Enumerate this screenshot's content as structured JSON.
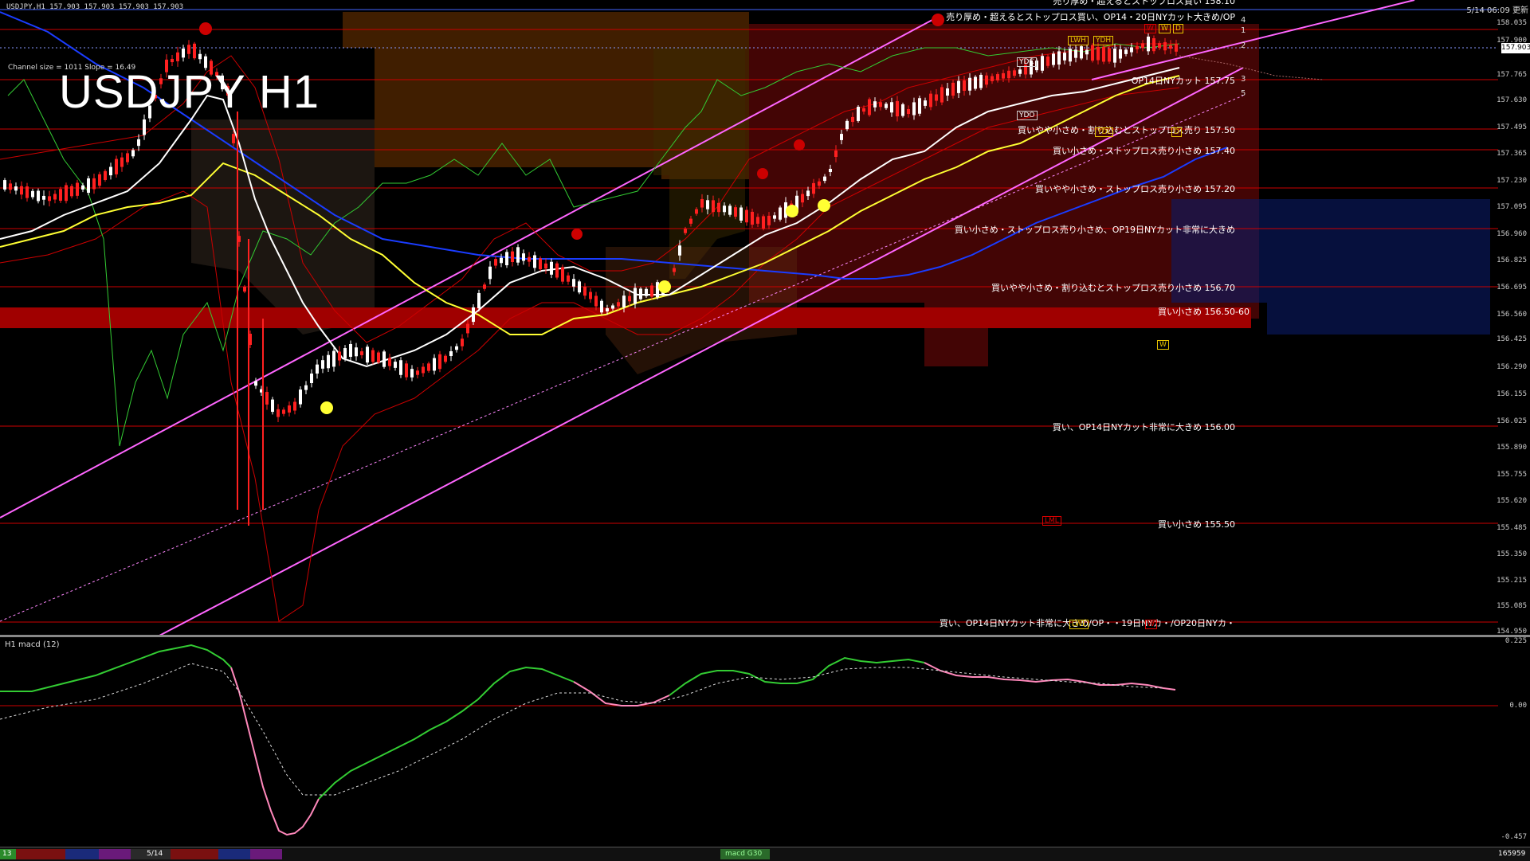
{
  "header": {
    "symbol_info": "USDJPY,H1  157.903 157.903 157.903 157.903",
    "big_title": "USDJPY H1",
    "channel_info": "Channel size = 1011 Slope = 16.49",
    "clock": "5/14 06:09 更新",
    "current_price": "157.903"
  },
  "price_axis": [
    "158.035",
    "157.900",
    "157.765",
    "157.630",
    "157.495",
    "157.365",
    "157.230",
    "157.095",
    "156.960",
    "156.825",
    "156.695",
    "156.560",
    "156.425",
    "156.290",
    "156.155",
    "156.025",
    "155.890",
    "155.755",
    "155.620",
    "155.485",
    "155.350",
    "155.215",
    "155.085",
    "154.950"
  ],
  "notes": [
    {
      "text": "売り厚め・超えるとストップロス買い 158.10"
    },
    {
      "text": "売り厚め・超えるとストップロス買い、OP14・20日NYカット大きめ/OP"
    },
    {
      "text": "OP14日NYカット 157.75"
    },
    {
      "text": "買いやや小さめ・割り込むとストップロス売り 157.50"
    },
    {
      "text": "買い小さめ・ストップロス売り小さめ 157.40"
    },
    {
      "text": "買いやや小さめ・ストップロス売り小さめ 157.20"
    },
    {
      "text": "買い小さめ・ストップロス売り小さめ、OP19日NYカット非常に大きめ"
    },
    {
      "text": "買いやや小さめ・割り込むとストップロス売り小さめ 156.70"
    },
    {
      "text": "買い小さめ 156.50-60"
    },
    {
      "text": "買い、OP14日NYカット非常に大きめ 156.00"
    },
    {
      "text": "買い小さめ 155.50"
    },
    {
      "text": "買い、OP14日NYカット非常に大きめ/OP・・19日NYカ・/OP20日NYカ・"
    }
  ],
  "level_tags": {
    "lwh": "LWH",
    "ydh": "YDH",
    "ydc": "YDC",
    "ydo": "YDO",
    "ydl": "YDL",
    "d": "D",
    "w": "W",
    "lml": "LML",
    "lwl": "LWL"
  },
  "level_numbers": [
    "4",
    "1",
    "2",
    "3",
    "5"
  ],
  "macd": {
    "title": "H1  macd (12)",
    "axis": [
      "0.225",
      "0.00",
      "-0.457"
    ]
  },
  "taskbar": {
    "t1": "13",
    "t2": "5/14",
    "t3": "macd G30",
    "t4": "165959"
  },
  "colors": {
    "bg": "#000000",
    "up_candle": "#ffffff",
    "down_candle": "#ff0000",
    "channel": "#ff66ff",
    "ma_white": "#ffffff",
    "ma_yellow": "#ffff33",
    "ma_blue": "#1a3cff",
    "chikou": "#33cc33",
    "band": "#cc0000",
    "level": "#cc0000"
  }
}
